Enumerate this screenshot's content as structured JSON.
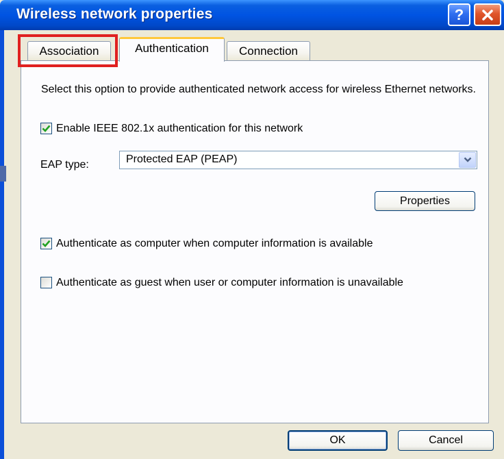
{
  "window": {
    "title": "Wireless network properties"
  },
  "tabs": [
    {
      "label": "Association",
      "selected": false
    },
    {
      "label": "Authentication",
      "selected": true
    },
    {
      "label": "Connection",
      "selected": false
    }
  ],
  "authentication": {
    "description": "Select this option to provide authenticated network access for wireless Ethernet networks.",
    "enable_ieee": {
      "label": "Enable IEEE 802.1x authentication for this network",
      "checked": true
    },
    "eap_type": {
      "label": "EAP type:",
      "value": "Protected EAP (PEAP)"
    },
    "properties_button": "Properties",
    "authenticate_computer": {
      "label": "Authenticate as computer when computer information is available",
      "checked": true
    },
    "authenticate_guest": {
      "label": "Authenticate as guest when user or computer information is unavailable",
      "checked": false
    }
  },
  "buttons": {
    "ok": "OK",
    "cancel": "Cancel"
  },
  "colors": {
    "title_bar": "#0054e3",
    "highlight": "#e02020",
    "check_mark": "#21a121",
    "tab_accent": "#ffc83c"
  }
}
